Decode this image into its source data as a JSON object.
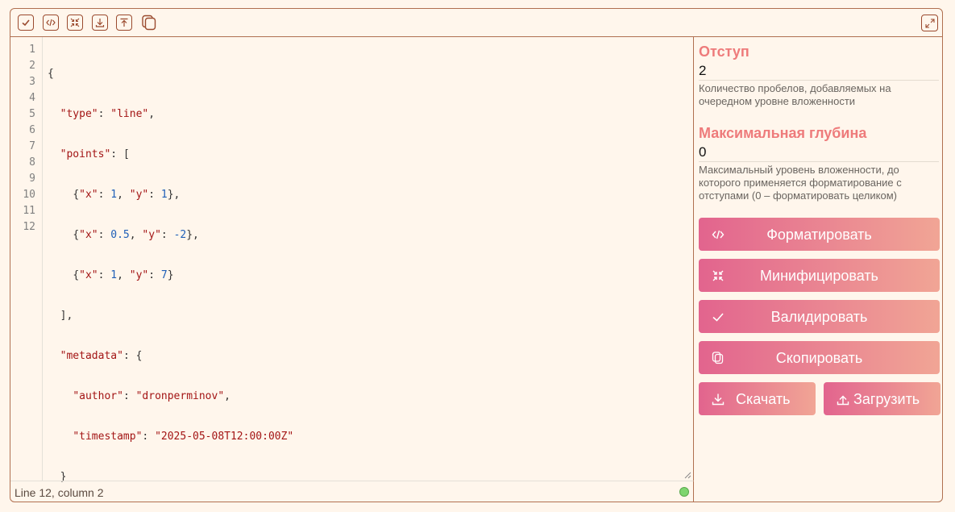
{
  "toolbar": {
    "buttons": [
      "validate-icon",
      "format-icon",
      "minify-icon",
      "download-icon",
      "upload-icon",
      "copy-icon"
    ],
    "fullscreen_icon": "expand-icon"
  },
  "editor": {
    "line_numbers": [
      "1",
      "2",
      "3",
      "4",
      "5",
      "6",
      "7",
      "8",
      "9",
      "10",
      "11",
      "12"
    ],
    "tokens": {
      "l1_open": "{",
      "l2_key": "\"type\"",
      "l2_colon": ": ",
      "l2_val": "\"line\"",
      "l2_comma": ",",
      "l3_key": "\"points\"",
      "l3_colon": ": ",
      "l3_open": "[",
      "l4_open": "{",
      "l4_k1": "\"x\"",
      "l4_c1": ": ",
      "l4_v1": "1",
      "l4_sep": ", ",
      "l4_k2": "\"y\"",
      "l4_c2": ": ",
      "l4_v2": "1",
      "l4_close": "},",
      "l5_open": "{",
      "l5_k1": "\"x\"",
      "l5_c1": ": ",
      "l5_v1": "0.5",
      "l5_sep": ", ",
      "l5_k2": "\"y\"",
      "l5_c2": ": ",
      "l5_v2": "-2",
      "l5_close": "},",
      "l6_open": "{",
      "l6_k1": "\"x\"",
      "l6_c1": ": ",
      "l6_v1": "1",
      "l6_sep": ", ",
      "l6_k2": "\"y\"",
      "l6_c2": ": ",
      "l6_v2": "7",
      "l6_close": "}",
      "l7_close": "],",
      "l8_key": "\"metadata\"",
      "l8_colon": ": ",
      "l8_open": "{",
      "l9_key": "\"author\"",
      "l9_colon": ": ",
      "l9_val": "\"dronperminov\"",
      "l9_comma": ",",
      "l10_key": "\"timestamp\"",
      "l10_colon": ": ",
      "l10_val": "\"2025-05-08T12:00:00Z\"",
      "l11_close": "}",
      "l12_close": "}"
    }
  },
  "status": {
    "cursor_position": "Line 12, column 2",
    "indicator_color": "#7ed56f"
  },
  "options": {
    "indent": {
      "title": "Отступ",
      "value": "2",
      "description": "Количество пробелов, добавляемых на очередном уровне вложенности"
    },
    "max_depth": {
      "title": "Максимальная глубина",
      "value": "0",
      "description": "Максимальный уровень вложенности, до которого применяется форматирование с отступами (0 – форматировать целиком)"
    }
  },
  "actions": {
    "format": "Форматировать",
    "minify": "Минифицировать",
    "validate": "Валидировать",
    "copy": "Скопировать",
    "download": "Скачать",
    "upload": "Загрузить"
  },
  "colors": {
    "accent_gradient_start": "#e2648e",
    "accent_gradient_end": "#f1a595",
    "option_title": "#ee7b7b",
    "border": "#b07050",
    "background": "#fff6ec"
  }
}
